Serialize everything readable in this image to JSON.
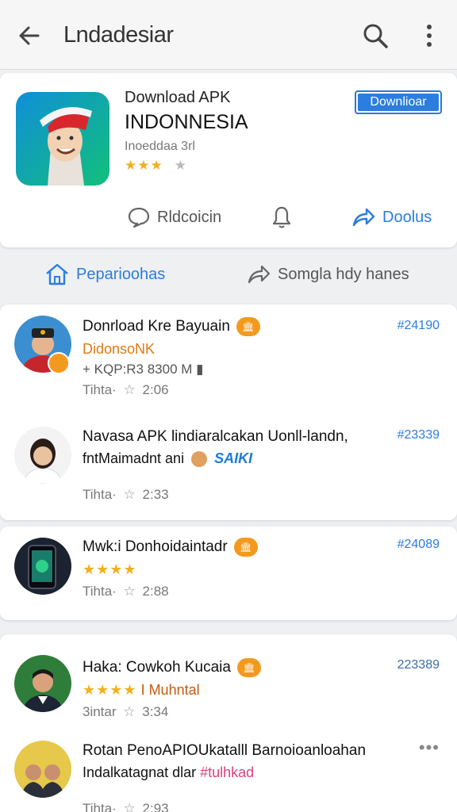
{
  "appbar": {
    "title": "Lndadesiar",
    "icons": [
      "back-arrow-icon",
      "search-icon",
      "more-vert-icon"
    ]
  },
  "hero": {
    "line1": "Download APK",
    "line2": "INDONNESIA",
    "line3": "Inoeddaa 3rl",
    "rating_text": "★★★",
    "rating_off": "★",
    "download_label": "Downlioar",
    "actions": [
      {
        "label": "Rldcoicin",
        "icon": "comment-icon"
      },
      {
        "label": "",
        "icon": "bell-icon"
      },
      {
        "label": "Doolus",
        "icon": "share-icon"
      }
    ]
  },
  "tabs": [
    {
      "label": "Peparioohas",
      "icon": "home-icon",
      "active": true
    },
    {
      "label": "Somgla hdy hanes",
      "icon": "share-icon",
      "active": false
    }
  ],
  "items": [
    {
      "title": "Donrload Kre Bayuain",
      "sub": "DidonsoNK",
      "meta1": "+ KQP:R3 8300 M ▮",
      "meta2_label": "Tihta·",
      "meta2_val": "2:06",
      "price": "#24190"
    },
    {
      "title": "Navasa APK lindiaralcakan Uonll-landn,",
      "sub": "fntMaimadnt ani",
      "sub_tag": "SAIKI",
      "meta2_label": "Tihta·",
      "meta2_val": "2:33",
      "price": "#23339"
    },
    {
      "title": "Mwk:i Donhoidaintadr",
      "stars": "★★★★",
      "meta2_label": "Tihta·",
      "meta2_val": "2:88",
      "price": "#24089"
    },
    {
      "title": "Haka: Cowkoh Kucaia",
      "stars": "★★★★",
      "sub_tag": "I Muhntal",
      "meta2_label": "3intar",
      "meta2_val": "3:34",
      "price": "223389"
    },
    {
      "title": "Rotan PenoAPIOUkatalll Barnoioanloahan",
      "sub": "Indalkatagnat dlar",
      "sub_tag": "#tulhkad",
      "meta2_label": "Tihta·",
      "meta2_val": "2:93",
      "more": "•••"
    }
  ],
  "badge_label": "🏛",
  "colors": {
    "accent": "#2b7de0",
    "star": "#f2b01e",
    "badge": "#f39a1e"
  }
}
